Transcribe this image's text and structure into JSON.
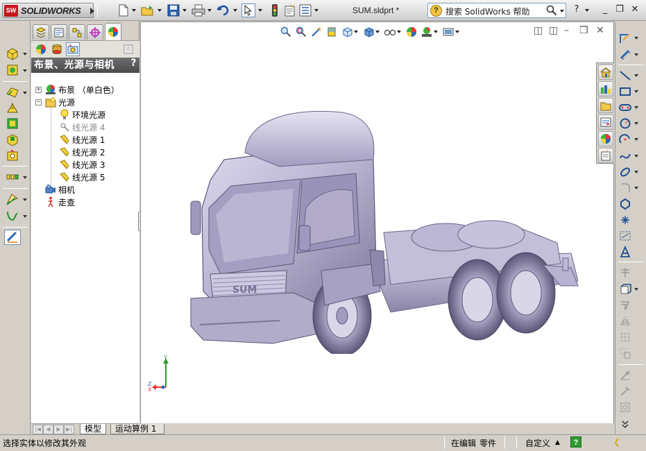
{
  "app": {
    "logo_badge": "SW",
    "logo_text": "SOLIDWORKS",
    "document_title": "SUM.sldprt *"
  },
  "search": {
    "placeholder": "搜索 SolidWorks 帮助",
    "help_glyph": "?"
  },
  "window_controls": {
    "help": "?",
    "minimize": "_",
    "restore": "❐",
    "close": "✕"
  },
  "feature_manager": {
    "header_title": "布景、光源与相机",
    "header_help": "?",
    "tree": [
      {
        "label": "布景 （单白色）",
        "icon": "scene-icon",
        "level": 0,
        "expander": "+",
        "dimmed": false
      },
      {
        "label": "光源",
        "icon": "lights-folder-icon",
        "level": 0,
        "expander": "−",
        "dimmed": false
      },
      {
        "label": "环境光源",
        "icon": "ambient-light-icon",
        "level": 1,
        "expander": "",
        "dimmed": false
      },
      {
        "label": "线光源 4",
        "icon": "directional-light-icon",
        "level": 1,
        "expander": "",
        "dimmed": true
      },
      {
        "label": "线光源 1",
        "icon": "directional-light-icon",
        "level": 1,
        "expander": "",
        "dimmed": false
      },
      {
        "label": "线光源 2",
        "icon": "directional-light-icon",
        "level": 1,
        "expander": "",
        "dimmed": false
      },
      {
        "label": "线光源 3",
        "icon": "directional-light-icon",
        "level": 1,
        "expander": "",
        "dimmed": false
      },
      {
        "label": "线光源 5",
        "icon": "directional-light-icon",
        "level": 1,
        "expander": "",
        "dimmed": false
      },
      {
        "label": "相机",
        "icon": "camera-icon",
        "level": 0,
        "expander": "",
        "dimmed": false
      },
      {
        "label": "走查",
        "icon": "walkthrough-icon",
        "level": 0,
        "expander": "",
        "dimmed": false
      }
    ]
  },
  "sheet_tabs": {
    "model": "模型",
    "motion": "运动算例 1"
  },
  "status": {
    "message": "选择实体以修改其外观",
    "editing": "在编辑",
    "doc_type": "零件",
    "units": "自定义",
    "help_badge": "?"
  },
  "model": {
    "grille_text": "SUM",
    "body_color": "#b9b4cf"
  },
  "axis_labels": {
    "x": "X",
    "y": "Y",
    "z": "Z"
  }
}
